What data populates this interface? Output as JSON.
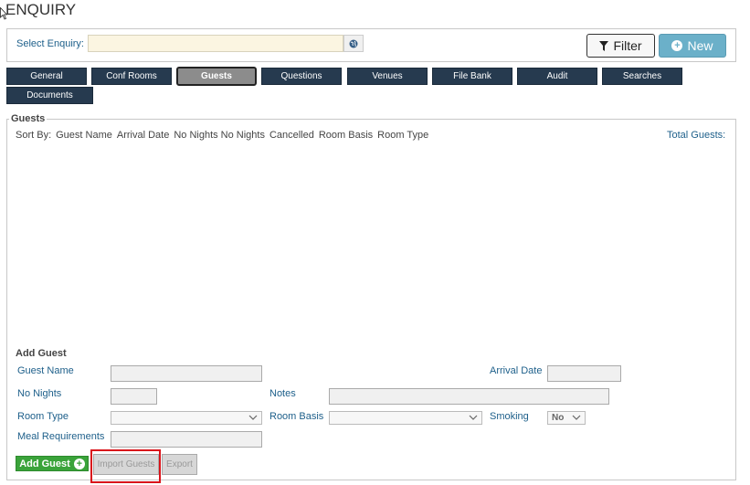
{
  "page": {
    "title": "ENQUIRY"
  },
  "enquiry": {
    "label": "Select Enquiry:",
    "value": "",
    "filter_label": "Filter",
    "new_label": "New"
  },
  "tabs": [
    {
      "label": "General",
      "active": false
    },
    {
      "label": "Conf Rooms",
      "active": false
    },
    {
      "label": "Guests",
      "active": true
    },
    {
      "label": "Questions",
      "active": false
    },
    {
      "label": "Venues",
      "active": false
    },
    {
      "label": "File Bank",
      "active": false
    },
    {
      "label": "Audit",
      "active": false
    },
    {
      "label": "Searches",
      "active": false
    },
    {
      "label": "Documents",
      "active": false
    }
  ],
  "guests": {
    "legend": "Guests",
    "sort_by_label": "Sort By:",
    "sort_options": [
      "Guest Name",
      "Arrival Date",
      "No Nights",
      "No Nights",
      "Cancelled",
      "Room Basis",
      "Room Type"
    ],
    "total_label": "Total Guests:"
  },
  "add_guest": {
    "title": "Add Guest",
    "guest_name_label": "Guest Name",
    "guest_name_value": "",
    "arrival_date_label": "Arrival Date",
    "arrival_date_value": "",
    "no_nights_label": "No Nights",
    "no_nights_value": "",
    "notes_label": "Notes",
    "notes_value": "",
    "room_type_label": "Room Type",
    "room_type_value": "",
    "room_basis_label": "Room Basis",
    "room_basis_value": "",
    "smoking_label": "Smoking",
    "smoking_value": "No",
    "meal_label": "Meal Requirements",
    "meal_value": "",
    "add_button": "Add Guest",
    "import_button": "Import Guests",
    "export_button": "Export"
  },
  "colors": {
    "tab_bg": "#263a4f",
    "tab_active_bg": "#8c8c8c",
    "link_blue": "#1d5f8a",
    "add_green": "#3aa33a",
    "new_button": "#6bb0c9",
    "highlight_red": "#d9141b",
    "enquiry_input_bg": "#fbf5e1"
  },
  "icons": {
    "globe": "globe-icon",
    "filter": "funnel-icon",
    "new": "plus-circle-icon",
    "add": "plus-circle-icon",
    "cursor": "mouse-cursor-icon"
  }
}
